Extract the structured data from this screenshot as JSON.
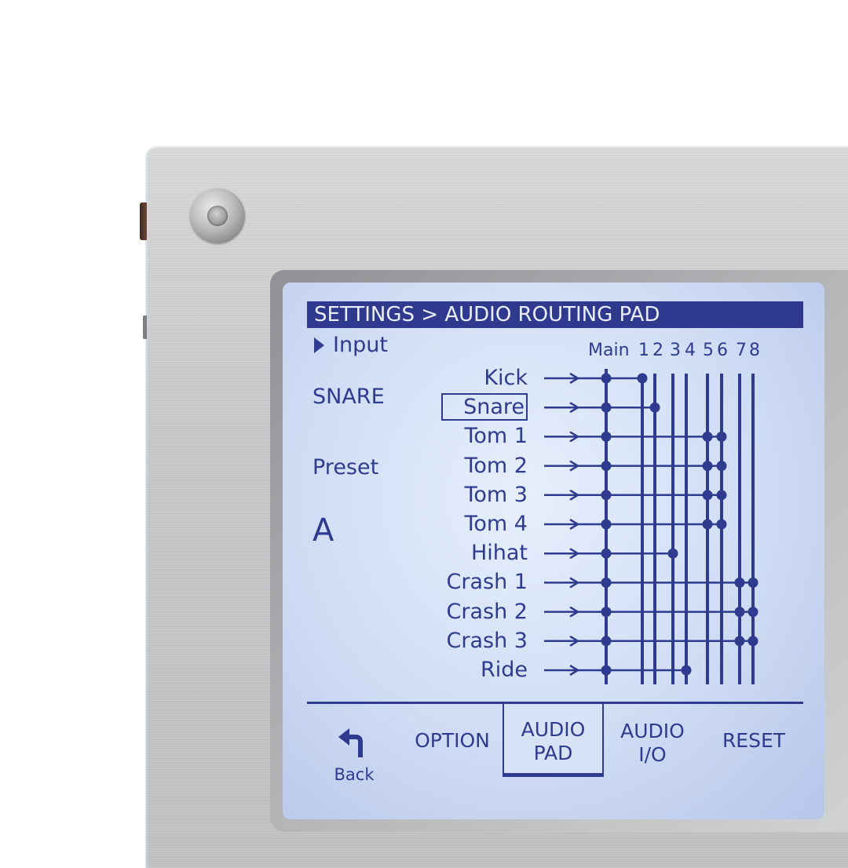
{
  "screen": {
    "title": "SETTINGS > AUDIO ROUTING PAD",
    "input_label": "Input",
    "instrument": "SNARE",
    "preset_label": "Preset",
    "preset_value": "A"
  },
  "outputs": {
    "header": [
      "Main",
      "1",
      "2",
      "3",
      "4",
      "5",
      "6",
      "7",
      "8"
    ]
  },
  "channels": [
    {
      "label": "Kick",
      "selected": false,
      "routes": [
        "Main",
        "1"
      ]
    },
    {
      "label": "Snare",
      "selected": true,
      "routes": [
        "Main",
        "2"
      ]
    },
    {
      "label": "Tom 1",
      "selected": false,
      "routes": [
        "Main",
        "5",
        "6"
      ]
    },
    {
      "label": "Tom 2",
      "selected": false,
      "routes": [
        "Main",
        "5",
        "6"
      ]
    },
    {
      "label": "Tom 3",
      "selected": false,
      "routes": [
        "Main",
        "5",
        "6"
      ]
    },
    {
      "label": "Tom 4",
      "selected": false,
      "routes": [
        "Main",
        "5",
        "6"
      ]
    },
    {
      "label": "Hihat",
      "selected": false,
      "routes": [
        "Main",
        "3"
      ]
    },
    {
      "label": "Crash 1",
      "selected": false,
      "routes": [
        "Main",
        "7",
        "8"
      ]
    },
    {
      "label": "Crash 2",
      "selected": false,
      "routes": [
        "Main",
        "7",
        "8"
      ]
    },
    {
      "label": "Crash 3",
      "selected": false,
      "routes": [
        "Main",
        "7",
        "8"
      ]
    },
    {
      "label": "Ride",
      "selected": false,
      "routes": [
        "Main",
        "4"
      ]
    }
  ],
  "softkeys": {
    "back": "Back",
    "option": "OPTION",
    "audio_pad_line1": "AUDIO",
    "audio_pad_line2": "PAD",
    "audio_io_line1": "AUDIO",
    "audio_io_line2": "I/O",
    "reset": "RESET",
    "active": "AUDIO PAD"
  },
  "colors": {
    "lcd_background": "#cfdcf4",
    "lcd_ink": "#2e3b8e",
    "title_bar": "#2f3a8e",
    "panel": "#c6c8ca"
  }
}
